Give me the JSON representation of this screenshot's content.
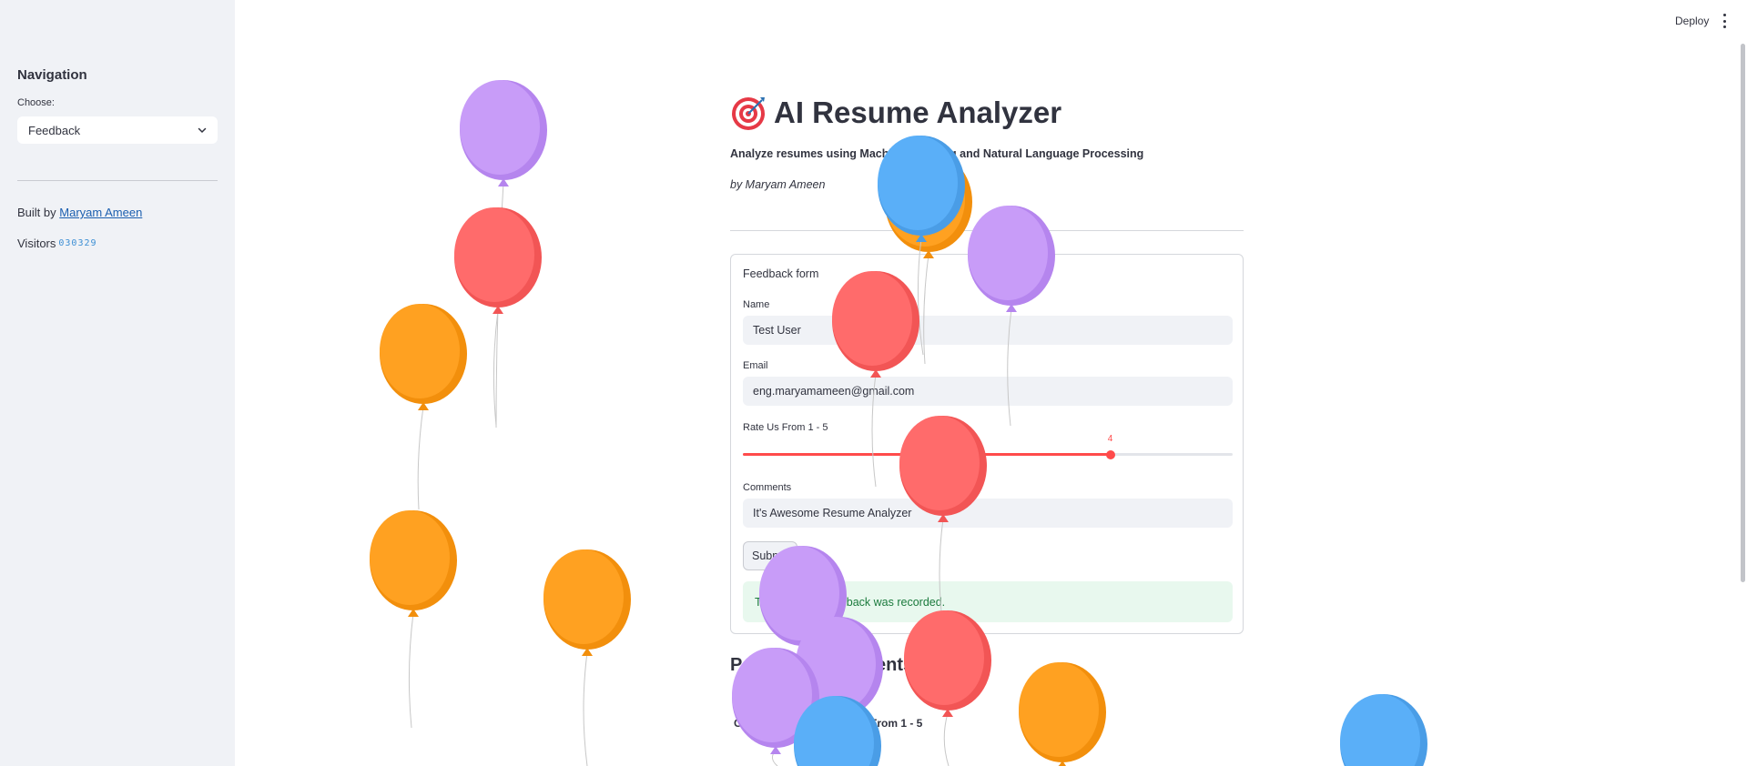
{
  "sidebar": {
    "title": "Navigation",
    "choose_label": "Choose:",
    "selected_page": "Feedback",
    "built_by_prefix": "Built by",
    "built_by_name": "Maryam Ameen",
    "visitors_label": "Visitors",
    "visitors_count": "030329"
  },
  "header": {
    "deploy_label": "Deploy"
  },
  "main": {
    "title": "AI Resume Analyzer",
    "title_icon": "target-icon",
    "subtitle": "Analyze resumes using Machine Learning and Natural Language Processing",
    "author": "by Maryam Ameen"
  },
  "form": {
    "title": "Feedback form",
    "name_label": "Name",
    "name_value": "Test User",
    "email_label": "Email",
    "email_value": "eng.maryamameen@gmail.com",
    "rating_label": "Rate Us From 1 - 5",
    "rating_value": "4",
    "rating_fraction": 0.75,
    "comments_label": "Comments",
    "comments_value": "It's Awesome Resume Analyzer",
    "submit_label": "Submit",
    "success_message": "Thanks! Your feedback was recorded."
  },
  "lower": {
    "section_heading": "Past User Comments",
    "col_left": "C",
    "col_rating": "From 1 - 5"
  },
  "colors": {
    "accent": "#ff4b4b",
    "sidebar_bg": "#f0f2f6",
    "balloon_purple": "#c89cf8",
    "balloon_red": "#ff6b6b",
    "balloon_orange": "#ffa121",
    "balloon_blue": "#5aaff8"
  }
}
